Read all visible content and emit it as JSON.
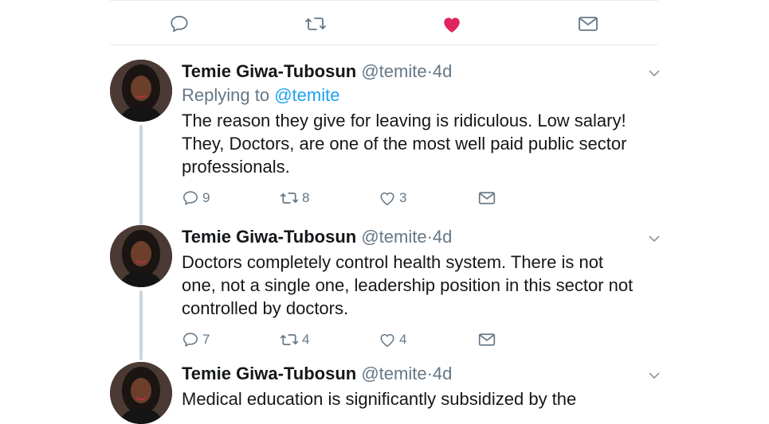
{
  "top_actions": {
    "icons": [
      "reply-icon",
      "retweet-icon",
      "heart-filled-icon",
      "mail-icon"
    ],
    "like_color": "#e0245e"
  },
  "tweets": [
    {
      "name": "Temie Giwa-Tubosun",
      "handle": "@temite",
      "dot": "·",
      "time": "4d",
      "replying_label": "Replying to",
      "replying_to": "@temite",
      "text": "The reason they give for leaving is ridiculous. Low salary!\nThey, Doctors, are one of the most well paid public sector\nprofessionals.",
      "replies": "9",
      "retweets": "8",
      "likes": "3"
    },
    {
      "name": "Temie Giwa-Tubosun",
      "handle": "@temite",
      "dot": "·",
      "time": "4d",
      "text": "Doctors completely control health system. There is not\none, not a single one, leadership position in this sector not\ncontrolled by doctors.",
      "replies": "7",
      "retweets": "4",
      "likes": "4"
    },
    {
      "name": "Temie Giwa-Tubosun",
      "handle": "@temite",
      "dot": "·",
      "time": "4d",
      "text": "Medical education is significantly subsidized by the"
    }
  ],
  "colors": {
    "accent": "#1da1f2",
    "muted": "#657786",
    "divider": "#e6ecf0",
    "thread_line": "#ccd6dd"
  }
}
